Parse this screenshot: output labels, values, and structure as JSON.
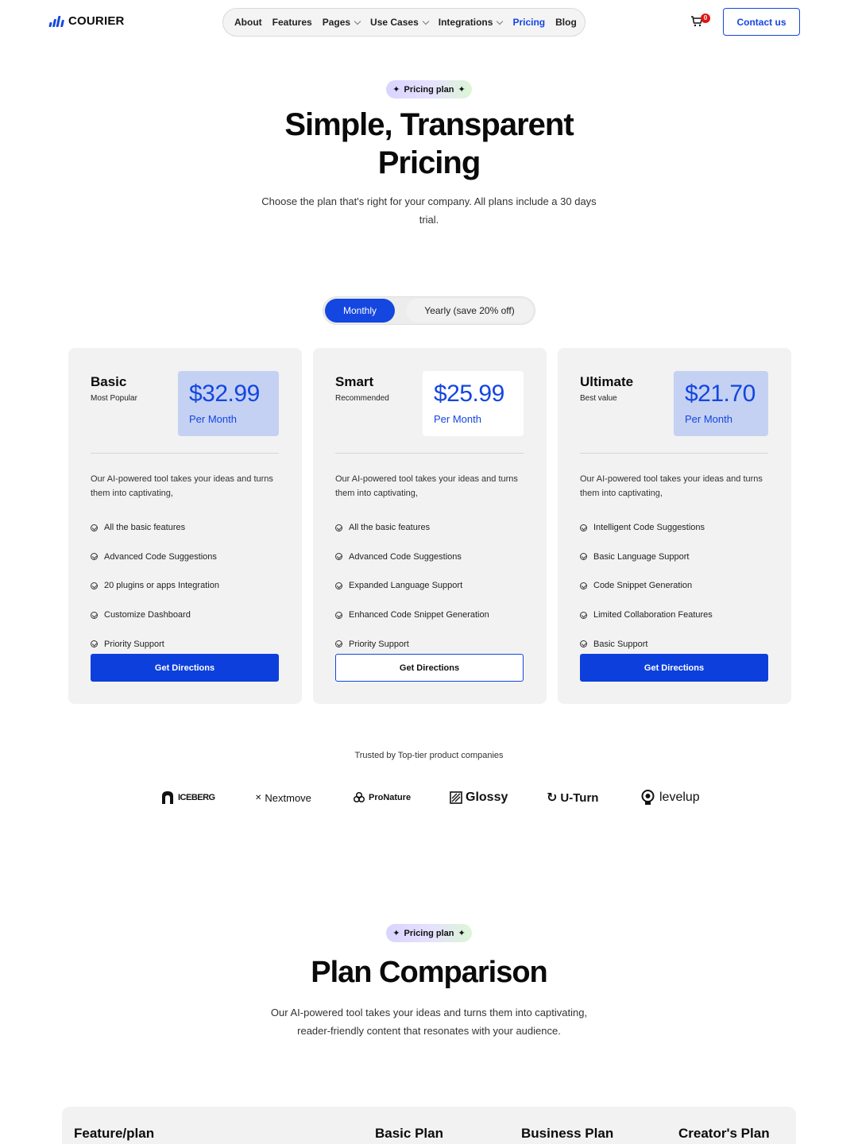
{
  "brand": {
    "name": "COURIER"
  },
  "nav": {
    "items": [
      {
        "label": "About",
        "dropdown": false,
        "active": false
      },
      {
        "label": "Features",
        "dropdown": false,
        "active": false
      },
      {
        "label": "Pages",
        "dropdown": true,
        "active": false
      },
      {
        "label": "Use Cases",
        "dropdown": true,
        "active": false
      },
      {
        "label": "Integrations",
        "dropdown": true,
        "active": false
      },
      {
        "label": "Pricing",
        "dropdown": false,
        "active": true
      },
      {
        "label": "Blog",
        "dropdown": false,
        "active": false
      }
    ],
    "cart_count": "0",
    "contact_label": "Contact us"
  },
  "hero": {
    "badge": "Pricing plan",
    "title_line1": "Simple, Transparent",
    "title_line2": "Pricing",
    "subtitle": "Choose the plan that's right for your company. All plans include a 30 days trial."
  },
  "billing_toggle": {
    "monthly_label": "Monthly",
    "yearly_label": "Yearly (save 20% off)",
    "selected": "Monthly"
  },
  "plans": [
    {
      "name": "Basic",
      "tag": "Most Popular",
      "price": "$32.99",
      "period": "Per Month",
      "description": "Our AI-powered tool takes your ideas and turns them into captivating,",
      "features": [
        "All the basic features",
        "Advanced Code Suggestions",
        "20 plugins or apps Integration",
        "Customize Dashboard",
        "Priority Support"
      ],
      "button_label": "Get Directions"
    },
    {
      "name": "Smart",
      "tag": "Recommended",
      "price": "$25.99",
      "period": "Per Month",
      "description": "Our AI-powered tool takes your ideas and turns them into captivating,",
      "features": [
        "All the basic features",
        "Advanced Code Suggestions",
        "Expanded Language Support",
        "Enhanced Code Snippet Generation",
        "Priority Support"
      ],
      "button_label": "Get Directions"
    },
    {
      "name": "Ultimate",
      "tag": "Best value",
      "price": "$21.70",
      "period": "Per Month",
      "description": "Our AI-powered tool takes your ideas and turns them into captivating,",
      "features": [
        "Intelligent Code Suggestions",
        "Basic Language Support",
        "Code Snippet Generation",
        "Limited Collaboration Features",
        "Basic Support"
      ],
      "button_label": "Get Directions"
    }
  ],
  "trusted": {
    "label": "Trusted by Top-tier product companies",
    "logos": [
      "ICEBERG",
      "Nextmove",
      "ProNature",
      "Glossy",
      "U-Turn",
      "levelup"
    ]
  },
  "comparison": {
    "badge": "Pricing plan",
    "title": "Plan Comparison",
    "subtitle_line1": "Our AI-powered tool takes your ideas and turns them into captivating,",
    "subtitle_line2": "reader-friendly content that resonates with your audience.",
    "columns": [
      "Feature/plan",
      "Basic Plan",
      "Business Plan",
      "Creator's Plan"
    ]
  },
  "colors": {
    "accent": "#1446e0",
    "price_box": "#c4d1f2",
    "card_bg": "#f2f2f2",
    "badge_red": "#e01414"
  }
}
